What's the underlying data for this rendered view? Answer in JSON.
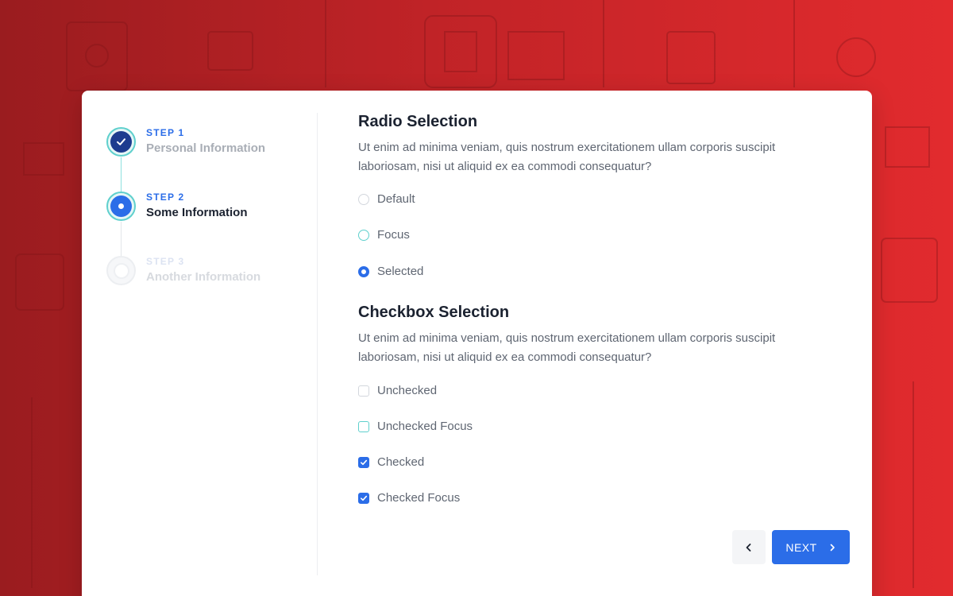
{
  "stepper": {
    "steps": [
      {
        "label": "STEP 1",
        "title": "Personal Information",
        "state": "completed"
      },
      {
        "label": "STEP 2",
        "title": "Some Information",
        "state": "active"
      },
      {
        "label": "STEP 3",
        "title": "Another Information",
        "state": "upcoming"
      }
    ]
  },
  "radio_section": {
    "title": "Radio Selection",
    "description": "Ut enim ad minima veniam, quis nostrum exercitationem ullam corporis suscipit laboriosam, nisi ut aliquid ex ea commodi consequatur?",
    "options": [
      {
        "label": "Default",
        "state": "default"
      },
      {
        "label": "Focus",
        "state": "focus"
      },
      {
        "label": "Selected",
        "state": "selected"
      }
    ]
  },
  "checkbox_section": {
    "title": "Checkbox Selection",
    "description": "Ut enim ad minima veniam, quis nostrum exercitationem ullam corporis suscipit laboriosam, nisi ut aliquid ex ea commodi consequatur?",
    "options": [
      {
        "label": "Unchecked",
        "state": "unchecked"
      },
      {
        "label": "Unchecked Focus",
        "state": "unchecked-focus"
      },
      {
        "label": "Checked",
        "state": "checked"
      },
      {
        "label": "Checked Focus",
        "state": "checked-focus"
      }
    ]
  },
  "actions": {
    "back_icon": "chevron-left-icon",
    "next_label": "NEXT",
    "next_icon": "chevron-right-icon"
  },
  "colors": {
    "accent": "#2b6de8",
    "focus": "#5fd0cd",
    "background_dark": "#9a1c1f",
    "background_light": "#e22b2e"
  }
}
